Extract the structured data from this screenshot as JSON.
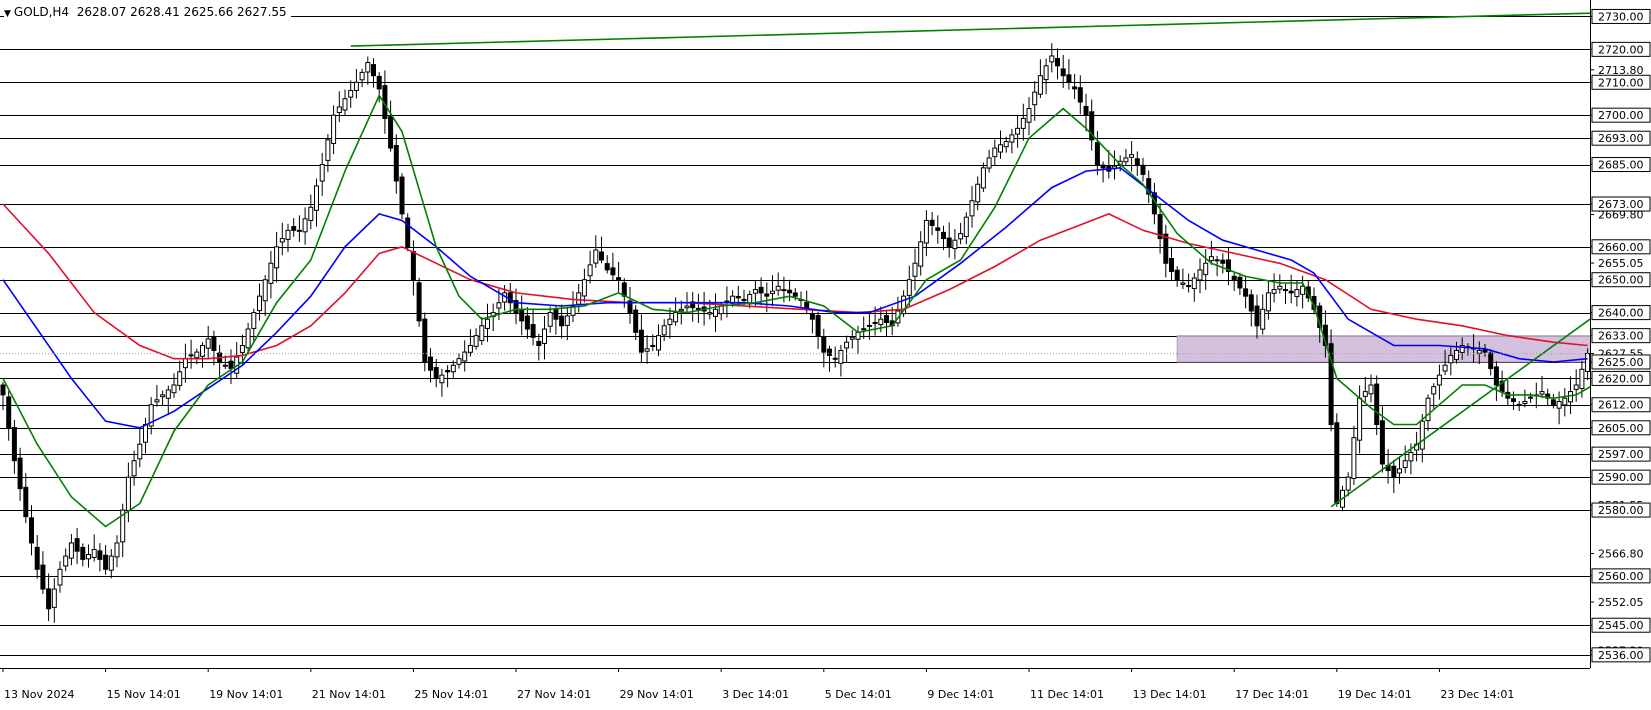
{
  "header": {
    "symbol": "GOLD,H4",
    "ohlc": "2628.07 2628.41 2625.66 2627.55"
  },
  "colors": {
    "background": "#ffffff",
    "bull_candle": "#ffffff",
    "bear_candle": "#000000",
    "ma_fast": "#008000",
    "ma_mid": "#0000ff",
    "ma_slow": "#e0102a",
    "trend_line": "#008000",
    "zone": "#cdb6d8",
    "level_lines": "#000000"
  },
  "chart_data": {
    "type": "candlestick",
    "symbol": "GOLD",
    "timeframe": "H4",
    "ylim": [
      2532,
      2735
    ],
    "y_axis_labels": [
      "2730.00",
      "2720.00",
      "2713.80",
      "2710.00",
      "2700.00",
      "2693.00",
      "2685.00",
      "2673.00",
      "2669.80",
      "2660.00",
      "2655.05",
      "2650.00",
      "2640.00",
      "2633.00",
      "2627.55",
      "2625.00",
      "2620.00",
      "2612.00",
      "2605.00",
      "2597.00",
      "2590.00",
      "2581.55",
      "2580.00",
      "2566.80",
      "2560.00",
      "2552.05",
      "2545.00",
      "2537.30",
      "2536.00"
    ],
    "highlighted_labels": [
      "2730.00",
      "2720.00",
      "2710.00",
      "2700.00",
      "2693.00",
      "2685.00",
      "2673.00",
      "2660.00",
      "2650.00",
      "2640.00",
      "2633.00",
      "2625.00",
      "2620.00",
      "2612.00",
      "2605.00",
      "2597.00",
      "2590.00",
      "2580.00",
      "2560.00",
      "2545.00",
      "2536.00"
    ],
    "horizontal_levels": [
      2730,
      2720,
      2710,
      2700,
      2693,
      2685,
      2673,
      2660,
      2650,
      2640,
      2633,
      2625,
      2620,
      2612,
      2605,
      2597,
      2590,
      2580,
      2560,
      2545,
      2536
    ],
    "current_price": 2627.55,
    "x_labels": [
      "13 Nov 2024",
      "15 Nov 14:01",
      "19 Nov 14:01",
      "21 Nov 14:01",
      "25 Nov 14:01",
      "27 Nov 14:01",
      "29 Nov 14:01",
      "3 Dec 14:01",
      "5 Dec 14:01",
      "9 Dec 14:01",
      "11 Dec 14:01",
      "13 Dec 14:01",
      "17 Dec 14:01",
      "19 Dec 14:01",
      "23 Dec 14:01"
    ],
    "x_label_bars": [
      0,
      18,
      36,
      54,
      72,
      90,
      108,
      126,
      144,
      162,
      180,
      198,
      216,
      234,
      252
    ],
    "total_bars": 300,
    "close_path": [
      [
        0,
        2615
      ],
      [
        2,
        2595
      ],
      [
        4,
        2578
      ],
      [
        6,
        2562
      ],
      [
        8,
        2550
      ],
      [
        10,
        2562
      ],
      [
        12,
        2570
      ],
      [
        14,
        2565
      ],
      [
        16,
        2568
      ],
      [
        18,
        2562
      ],
      [
        20,
        2570
      ],
      [
        22,
        2590
      ],
      [
        24,
        2600
      ],
      [
        26,
        2612
      ],
      [
        28,
        2615
      ],
      [
        30,
        2618
      ],
      [
        32,
        2626
      ],
      [
        34,
        2628
      ],
      [
        36,
        2632
      ],
      [
        38,
        2625
      ],
      [
        40,
        2623
      ],
      [
        42,
        2630
      ],
      [
        44,
        2640
      ],
      [
        46,
        2650
      ],
      [
        48,
        2660
      ],
      [
        50,
        2665
      ],
      [
        52,
        2665
      ],
      [
        54,
        2672
      ],
      [
        56,
        2685
      ],
      [
        58,
        2700
      ],
      [
        60,
        2705
      ],
      [
        62,
        2710
      ],
      [
        64,
        2716
      ],
      [
        66,
        2708
      ],
      [
        68,
        2690
      ],
      [
        70,
        2670
      ],
      [
        72,
        2650
      ],
      [
        74,
        2625
      ],
      [
        76,
        2620
      ],
      [
        78,
        2622
      ],
      [
        80,
        2626
      ],
      [
        82,
        2630
      ],
      [
        84,
        2636
      ],
      [
        86,
        2640
      ],
      [
        88,
        2646
      ],
      [
        90,
        2640
      ],
      [
        92,
        2635
      ],
      [
        94,
        2630
      ],
      [
        96,
        2640
      ],
      [
        98,
        2636
      ],
      [
        100,
        2642
      ],
      [
        102,
        2650
      ],
      [
        104,
        2659
      ],
      [
        106,
        2653
      ],
      [
        108,
        2650
      ],
      [
        110,
        2640
      ],
      [
        112,
        2628
      ],
      [
        114,
        2630
      ],
      [
        116,
        2636
      ],
      [
        118,
        2640
      ],
      [
        120,
        2642
      ],
      [
        122,
        2641
      ],
      [
        124,
        2640
      ],
      [
        126,
        2642
      ],
      [
        128,
        2645
      ],
      [
        130,
        2644
      ],
      [
        132,
        2647
      ],
      [
        134,
        2645
      ],
      [
        136,
        2648
      ],
      [
        138,
        2646
      ],
      [
        140,
        2644
      ],
      [
        142,
        2638
      ],
      [
        144,
        2628
      ],
      [
        146,
        2626
      ],
      [
        148,
        2631
      ],
      [
        150,
        2634
      ],
      [
        152,
        2636
      ],
      [
        154,
        2638
      ],
      [
        156,
        2636
      ],
      [
        158,
        2645
      ],
      [
        160,
        2655
      ],
      [
        162,
        2668
      ],
      [
        164,
        2665
      ],
      [
        166,
        2660
      ],
      [
        168,
        2664
      ],
      [
        170,
        2674
      ],
      [
        172,
        2684
      ],
      [
        174,
        2690
      ],
      [
        176,
        2692
      ],
      [
        178,
        2696
      ],
      [
        180,
        2702
      ],
      [
        182,
        2712
      ],
      [
        184,
        2718
      ],
      [
        186,
        2712
      ],
      [
        188,
        2708
      ],
      [
        190,
        2700
      ],
      [
        192,
        2685
      ],
      [
        194,
        2683
      ],
      [
        196,
        2686
      ],
      [
        198,
        2688
      ],
      [
        200,
        2682
      ],
      [
        202,
        2670
      ],
      [
        204,
        2655
      ],
      [
        206,
        2650
      ],
      [
        208,
        2648
      ],
      [
        210,
        2653
      ],
      [
        212,
        2657
      ],
      [
        214,
        2655
      ],
      [
        216,
        2650
      ],
      [
        218,
        2645
      ],
      [
        220,
        2636
      ],
      [
        222,
        2646
      ],
      [
        224,
        2648
      ],
      [
        226,
        2646
      ],
      [
        228,
        2648
      ],
      [
        230,
        2641
      ],
      [
        232,
        2630
      ],
      [
        234,
        2582
      ],
      [
        236,
        2590
      ],
      [
        238,
        2614
      ],
      [
        240,
        2618
      ],
      [
        242,
        2594
      ],
      [
        244,
        2590
      ],
      [
        246,
        2595
      ],
      [
        248,
        2600
      ],
      [
        250,
        2614
      ],
      [
        252,
        2621
      ],
      [
        254,
        2627
      ],
      [
        256,
        2630
      ],
      [
        258,
        2629
      ],
      [
        260,
        2628
      ],
      [
        262,
        2618
      ],
      [
        264,
        2614
      ],
      [
        266,
        2612
      ],
      [
        268,
        2614
      ],
      [
        270,
        2616
      ],
      [
        272,
        2612
      ],
      [
        274,
        2614
      ],
      [
        276,
        2618
      ],
      [
        278,
        2627.55
      ]
    ],
    "ma_fast_path": [
      [
        0,
        2620
      ],
      [
        6,
        2600
      ],
      [
        12,
        2584
      ],
      [
        18,
        2575
      ],
      [
        24,
        2582
      ],
      [
        30,
        2604
      ],
      [
        36,
        2618
      ],
      [
        42,
        2625
      ],
      [
        48,
        2643
      ],
      [
        54,
        2656
      ],
      [
        60,
        2683
      ],
      [
        66,
        2706
      ],
      [
        70,
        2695
      ],
      [
        76,
        2660
      ],
      [
        80,
        2645
      ],
      [
        84,
        2638
      ],
      [
        90,
        2641
      ],
      [
        96,
        2641
      ],
      [
        102,
        2642
      ],
      [
        108,
        2646
      ],
      [
        114,
        2641
      ],
      [
        120,
        2640
      ],
      [
        126,
        2642
      ],
      [
        132,
        2643
      ],
      [
        138,
        2645
      ],
      [
        144,
        2642
      ],
      [
        150,
        2634
      ],
      [
        156,
        2636
      ],
      [
        162,
        2650
      ],
      [
        168,
        2656
      ],
      [
        174,
        2672
      ],
      [
        180,
        2693
      ],
      [
        186,
        2702
      ],
      [
        190,
        2696
      ],
      [
        196,
        2685
      ],
      [
        200,
        2679
      ],
      [
        206,
        2664
      ],
      [
        212,
        2655
      ],
      [
        218,
        2651
      ],
      [
        224,
        2649
      ],
      [
        228,
        2649
      ],
      [
        230,
        2642
      ],
      [
        234,
        2620
      ],
      [
        240,
        2611
      ],
      [
        244,
        2606
      ],
      [
        248,
        2606
      ],
      [
        252,
        2612
      ],
      [
        256,
        2618
      ],
      [
        260,
        2618
      ],
      [
        264,
        2615
      ],
      [
        268,
        2615
      ],
      [
        272,
        2614
      ],
      [
        276,
        2615
      ],
      [
        279,
        2618
      ]
    ],
    "ma_mid_path": [
      [
        0,
        2650
      ],
      [
        6,
        2635
      ],
      [
        12,
        2620
      ],
      [
        18,
        2607
      ],
      [
        24,
        2605
      ],
      [
        30,
        2610
      ],
      [
        36,
        2617
      ],
      [
        42,
        2624
      ],
      [
        48,
        2634
      ],
      [
        54,
        2645
      ],
      [
        60,
        2660
      ],
      [
        66,
        2670
      ],
      [
        70,
        2668
      ],
      [
        76,
        2660
      ],
      [
        82,
        2651
      ],
      [
        90,
        2643
      ],
      [
        98,
        2642
      ],
      [
        106,
        2643
      ],
      [
        114,
        2643
      ],
      [
        122,
        2643
      ],
      [
        130,
        2643
      ],
      [
        138,
        2642
      ],
      [
        146,
        2640
      ],
      [
        152,
        2640
      ],
      [
        160,
        2645
      ],
      [
        168,
        2655
      ],
      [
        176,
        2666
      ],
      [
        184,
        2678
      ],
      [
        190,
        2683
      ],
      [
        196,
        2684
      ],
      [
        202,
        2676
      ],
      [
        208,
        2668
      ],
      [
        214,
        2662
      ],
      [
        220,
        2659
      ],
      [
        226,
        2656
      ],
      [
        230,
        2652
      ],
      [
        236,
        2638
      ],
      [
        244,
        2630
      ],
      [
        252,
        2630
      ],
      [
        260,
        2629
      ],
      [
        266,
        2626
      ],
      [
        272,
        2625
      ],
      [
        278,
        2626
      ]
    ],
    "ma_slow_path": [
      [
        0,
        2673
      ],
      [
        8,
        2658
      ],
      [
        16,
        2640
      ],
      [
        24,
        2630
      ],
      [
        30,
        2626
      ],
      [
        36,
        2626
      ],
      [
        42,
        2627
      ],
      [
        48,
        2630
      ],
      [
        54,
        2636
      ],
      [
        60,
        2646
      ],
      [
        66,
        2658
      ],
      [
        70,
        2660
      ],
      [
        76,
        2655
      ],
      [
        82,
        2650
      ],
      [
        90,
        2646
      ],
      [
        100,
        2644
      ],
      [
        110,
        2643
      ],
      [
        120,
        2643
      ],
      [
        130,
        2642
      ],
      [
        140,
        2641
      ],
      [
        150,
        2640
      ],
      [
        158,
        2641
      ],
      [
        166,
        2647
      ],
      [
        174,
        2654
      ],
      [
        182,
        2662
      ],
      [
        188,
        2666
      ],
      [
        194,
        2670
      ],
      [
        200,
        2665
      ],
      [
        208,
        2661
      ],
      [
        216,
        2658
      ],
      [
        224,
        2655
      ],
      [
        232,
        2650
      ],
      [
        240,
        2641
      ],
      [
        248,
        2638
      ],
      [
        256,
        2636
      ],
      [
        264,
        2633
      ],
      [
        272,
        2631
      ],
      [
        278,
        2630
      ]
    ],
    "trend_lines": [
      {
        "from": [
          61,
          2721
        ],
        "to": [
          300,
          2731
        ]
      },
      {
        "from": [
          233,
          2581
        ],
        "to": [
          300,
          2638
        ]
      }
    ],
    "zone": {
      "x_from": 206,
      "x_to": 282,
      "y_from": 2625,
      "y_to": 2633
    }
  }
}
